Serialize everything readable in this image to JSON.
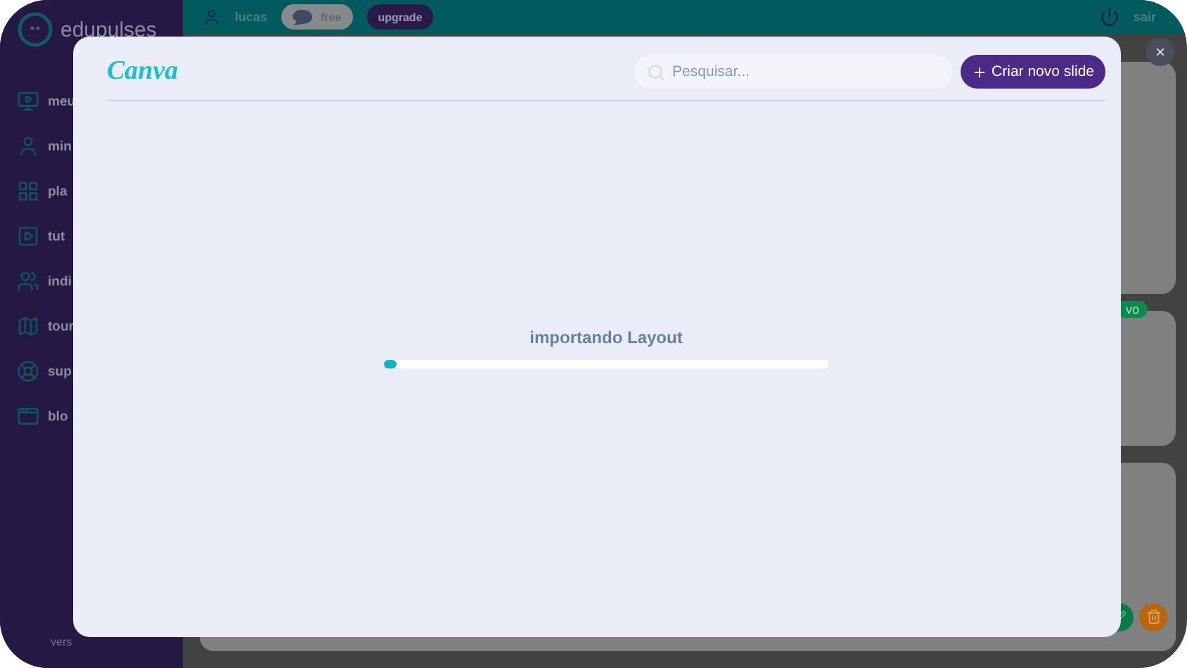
{
  "app": {
    "logo": "edupulses",
    "sidebar": {
      "items": [
        {
          "label": "meu"
        },
        {
          "label": "min"
        },
        {
          "label": "pla"
        },
        {
          "label": "tut"
        },
        {
          "label": "indi"
        },
        {
          "label": "tour"
        },
        {
          "label": "sup"
        },
        {
          "label": "blo"
        }
      ],
      "version": "vers"
    },
    "topbar": {
      "user": "lucas",
      "plan": "free",
      "upgrade": "upgrade",
      "logout": "sair"
    },
    "badge": "vo"
  },
  "modal": {
    "brand": "Canva",
    "search": {
      "placeholder": "Pesquisar..."
    },
    "create_button": "Criar novo slide",
    "close": "×",
    "status": "importando Layout",
    "progress": {
      "level": 0.02
    }
  }
}
